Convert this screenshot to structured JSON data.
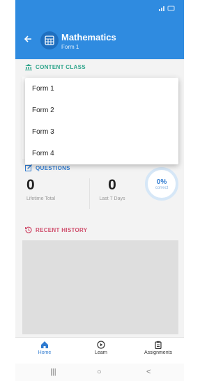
{
  "header": {
    "title": "Mathematics",
    "subtitle": "Form 1"
  },
  "sections": {
    "content_class": "CONTENT CLASS",
    "questions": "QUESTIONS",
    "recent_history": "RECENT HISTORY"
  },
  "dropdown": {
    "options": [
      "Form 1",
      "Form 2",
      "Form 3",
      "Form 4"
    ]
  },
  "stats": {
    "lifetime_total": {
      "value": "0",
      "label": "Lifetime Total"
    },
    "last_7_days": {
      "value": "0",
      "label": "Last 7 Days"
    },
    "correct": {
      "value": "0%",
      "label": "correct"
    }
  },
  "bottom_nav": {
    "items": [
      {
        "label": "Home",
        "icon": "home-icon"
      },
      {
        "label": "Learn",
        "icon": "play-circle-icon"
      },
      {
        "label": "Assignments",
        "icon": "clipboard-icon"
      }
    ]
  },
  "system_nav": {
    "recents": "|||",
    "home": "○",
    "back": "<"
  },
  "colors": {
    "header": "#2f8be0",
    "content_class_accent": "#2fa58b",
    "questions_accent": "#2f7bd0",
    "recent_accent": "#d0506e"
  }
}
